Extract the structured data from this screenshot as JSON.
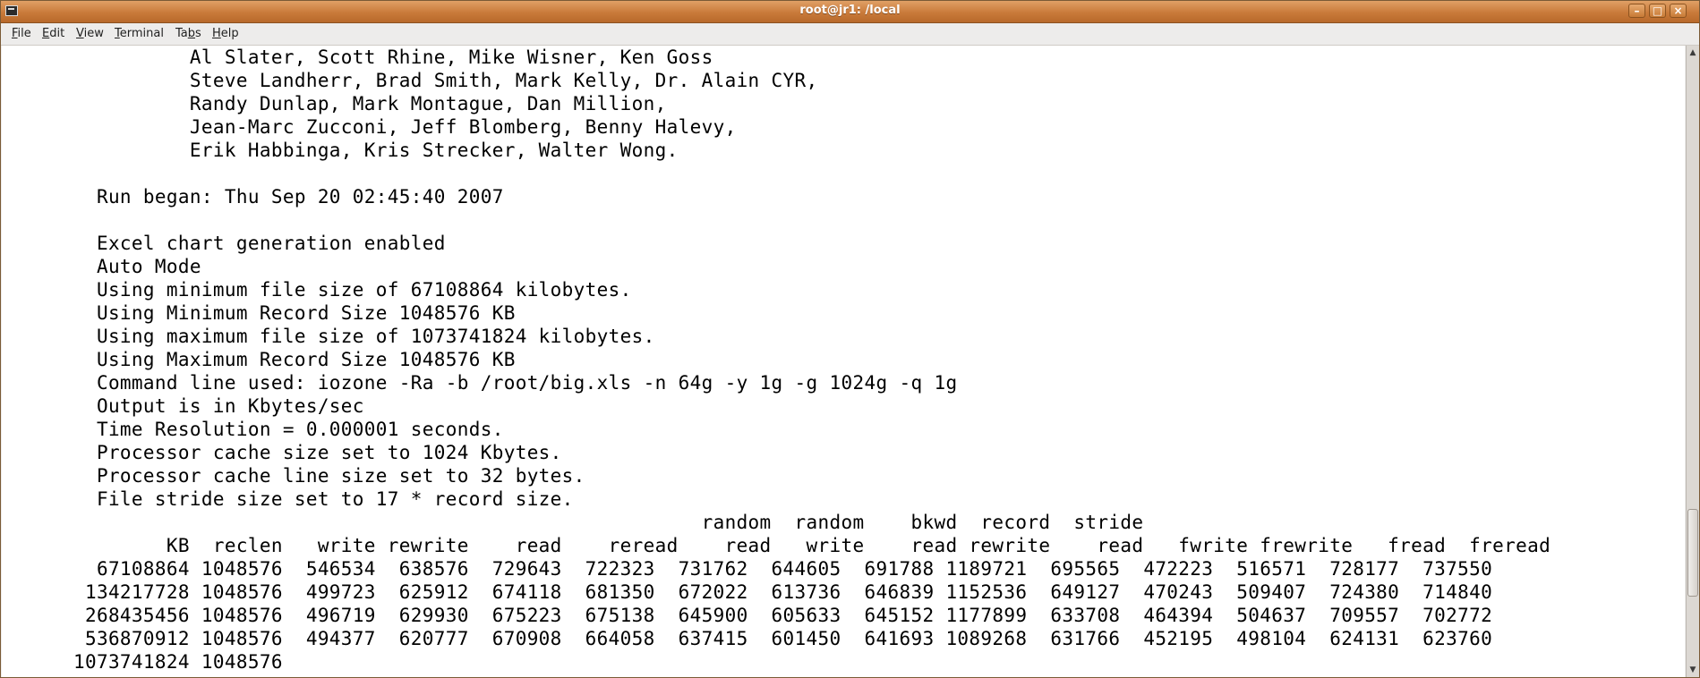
{
  "window": {
    "title": "root@jr1: /local",
    "controls": {
      "minimize": "–",
      "maximize": "□",
      "close": "×"
    }
  },
  "menubar": {
    "items": [
      {
        "label": "File",
        "mnemonic": "F",
        "rest": "ile"
      },
      {
        "label": "Edit",
        "mnemonic": "E",
        "rest": "dit"
      },
      {
        "label": "View",
        "mnemonic": "V",
        "rest": "iew"
      },
      {
        "label": "Terminal",
        "mnemonic": "T",
        "rest": "erminal"
      },
      {
        "label": "Tabs",
        "mnemonic": "",
        "pre": "Ta",
        "mn2": "b",
        "rest2": "s"
      },
      {
        "label": "Help",
        "mnemonic": "H",
        "rest": "elp"
      }
    ]
  },
  "terminal": {
    "lines": [
      "                Al Slater, Scott Rhine, Mike Wisner, Ken Goss",
      "                Steve Landherr, Brad Smith, Mark Kelly, Dr. Alain CYR,",
      "                Randy Dunlap, Mark Montague, Dan Million,",
      "                Jean-Marc Zucconi, Jeff Blomberg, Benny Halevy,",
      "                Erik Habbinga, Kris Strecker, Walter Wong.",
      "",
      "        Run began: Thu Sep 20 02:45:40 2007",
      "",
      "        Excel chart generation enabled",
      "        Auto Mode",
      "        Using minimum file size of 67108864 kilobytes.",
      "        Using Minimum Record Size 1048576 KB",
      "        Using maximum file size of 1073741824 kilobytes.",
      "        Using Maximum Record Size 1048576 KB",
      "        Command line used: iozone -Ra -b /root/big.xls -n 64g -y 1g -g 1024g -q 1g",
      "        Output is in Kbytes/sec",
      "        Time Resolution = 0.000001 seconds.",
      "        Processor cache size set to 1024 Kbytes.",
      "        Processor cache line size set to 32 bytes.",
      "        File stride size set to 17 * record size.",
      "                                                            random  random    bkwd  record  stride",
      "              KB  reclen   write rewrite    read    reread    read   write    read rewrite    read   fwrite frewrite   fread  freread",
      "        67108864 1048576  546534  638576  729643  722323  731762  644605  691788 1189721  695565  472223  516571  728177  737550",
      "       134217728 1048576  499723  625912  674118  681350  672022  613736  646839 1152536  649127  470243  509407  724380  714840",
      "       268435456 1048576  496719  629930  675223  675138  645900  605633  645152 1177899  633708  464394  504637  709557  702772",
      "       536870912 1048576  494377  620777  670908  664058  637415  601450  641693 1089268  631766  452195  498104  624131  623760",
      "      1073741824 1048576"
    ]
  },
  "scrollbar": {
    "up_arrow": "▲",
    "down_arrow": "▼",
    "position_fraction": 0.87
  }
}
